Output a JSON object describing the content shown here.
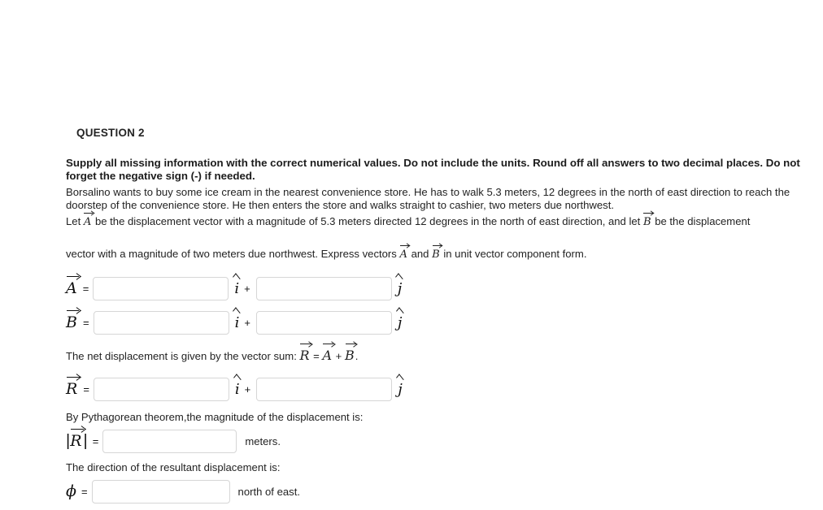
{
  "question": {
    "header": "QUESTION 2",
    "instructions": "Supply all missing information with the correct numerical values. Do not include the units. Round off all answers to two decimal places. Do not forget the negative sign (-) if needed.",
    "paragraph_1": "Borsalino wants to buy some ice cream in the nearest convenience store. He has to walk 5.3 meters, 12 degrees in the north of east direction to reach the doorstep of the convenience store. He then enters the store and walks straight to cashier, two meters due northwest.",
    "paragraph_2_part1": "Let",
    "paragraph_2_part2": "be the displacement vector with a magnitude of 5.3 meters directed 12 degrees in the north of east direction, and let",
    "paragraph_2_part3": "be the displacement",
    "paragraph_3_part1": "vector with a magnitude of two meters due northwest. Express vectors",
    "paragraph_3_part2": "and",
    "paragraph_3_part3": "in unit vector component form.",
    "net_displacement_text": "The net displacement is given by the vector sum:",
    "net_displacement_equation_lhs": "R",
    "net_displacement_equation_eq": "=",
    "net_displacement_equation_a": "A",
    "net_displacement_equation_plus": "+",
    "net_displacement_equation_b": "B",
    "net_displacement_equation_period": ".",
    "pythagorean_text": "By Pythagorean theorem,the magnitude of the displacement is:",
    "direction_text": "The direction of the resultant displacement is:"
  },
  "symbols": {
    "vector_a": "A",
    "vector_b": "B",
    "vector_r": "R",
    "i_hat": "i",
    "j_hat": "j",
    "phi": "ϕ",
    "equals": "=",
    "plus": "+",
    "abs_bar": "|"
  },
  "answer_rows": [
    {
      "name": "vector-a",
      "label": "A",
      "equals": "=",
      "x_value": "",
      "x_placeholder": "",
      "i_unit": "i",
      "plus": "+",
      "y_value": "",
      "y_placeholder": "",
      "j_unit": "j"
    },
    {
      "name": "vector-b",
      "label": "B",
      "equals": "=",
      "x_value": "",
      "x_placeholder": "",
      "i_unit": "i",
      "plus": "+",
      "y_value": "",
      "y_placeholder": "",
      "j_unit": "j"
    },
    {
      "name": "vector-r",
      "label": "R",
      "equals": "=",
      "x_value": "",
      "x_placeholder": "",
      "i_unit": "i",
      "plus": "+",
      "y_value": "",
      "y_placeholder": "",
      "j_unit": "j"
    }
  ],
  "magnitude_row": {
    "label": "R",
    "equals": "=",
    "value": "",
    "placeholder": "",
    "unit_text": "meters."
  },
  "direction_row": {
    "label": "ϕ",
    "equals": "=",
    "value": "",
    "placeholder": "",
    "unit_text": "north of east."
  },
  "colors": {
    "background": "#ffffff",
    "text": "#232323",
    "heading": "#252525",
    "input_border": "#d6d6d6"
  }
}
